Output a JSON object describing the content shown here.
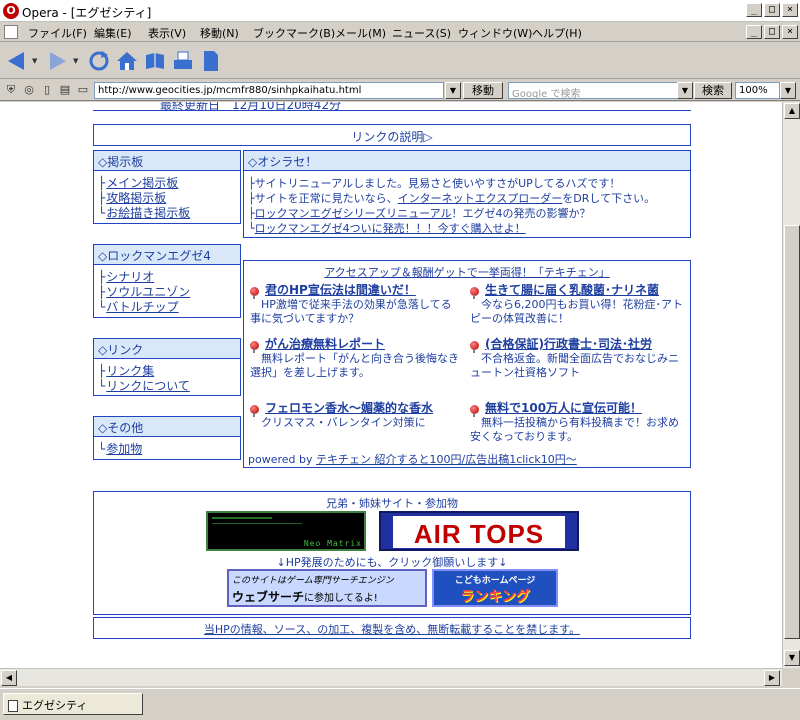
{
  "window": {
    "app_icon": "opera-o-icon",
    "title": "Opera - [エグゼシティ]",
    "buttons": [
      "_",
      "□",
      "×"
    ]
  },
  "menu": {
    "items": [
      "ファイル(F)",
      "編集(E)",
      "表示(V)",
      "移動(N)",
      "ブックマーク(B)",
      "メール(M)",
      "ニュース(S)",
      "ウィンドウ(W)",
      "ヘルプ(H)"
    ]
  },
  "toolbar": {
    "icons": [
      "back-icon",
      "forward-icon",
      "reload-icon",
      "home-icon",
      "bookmarks-icon",
      "print-icon",
      "page-icon"
    ]
  },
  "address": {
    "url": "http://www.geocities.jp/mcmfr880/sinhpkaihatu.html",
    "go_label": "移動",
    "search_placeholder": "Google で検索",
    "search_label": "検索",
    "zoom": "100%"
  },
  "page": {
    "cut_top": "最終更新日　12月10日20時42分",
    "link_desc": "リンクの説明▷",
    "keijiban": {
      "header": "◇掲示板",
      "items": [
        {
          "prefix": "├",
          "text": "メイン掲示板"
        },
        {
          "prefix": "├",
          "text": "攻略掲示板"
        },
        {
          "prefix": "└",
          "text": "お絵描き掲示板"
        }
      ]
    },
    "oshirase": {
      "header": "◇オシラセ！",
      "items": [
        {
          "prefix": "├",
          "text": "サイトリニューアルしました。見易さと使いやすさがUPしてるハズです！"
        },
        {
          "prefix": "├",
          "text": "サイトを正常に見たいなら、",
          "link": "インターネットエクスプローダー",
          "suffix": "をDRして下さい。"
        },
        {
          "prefix": "├",
          "link": "ロックマンエグゼシリーズリニューアル",
          "suffix": "！エグゼ4の発売の影響か？"
        },
        {
          "prefix": "└",
          "link": "ロックマンエグゼ4ついに発売！！！今すぐ購入せよ！"
        }
      ]
    },
    "rockman": {
      "header": "◇ロックマンエグゼ4",
      "items": [
        {
          "prefix": "├",
          "text": "シナリオ"
        },
        {
          "prefix": "├",
          "text": "ソウルユニゾン"
        },
        {
          "prefix": "└",
          "text": "バトルチップ"
        }
      ]
    },
    "link": {
      "header": "◇リンク",
      "items": [
        {
          "prefix": "├",
          "text": "リンク集"
        },
        {
          "prefix": "└",
          "text": "リンクについて"
        }
      ]
    },
    "sonota": {
      "header": "◇その他",
      "items": [
        {
          "prefix": "└",
          "text": "参加物"
        }
      ]
    },
    "ads": {
      "header": "アクセスアップ＆報酬ゲットで一挙両得！「テキチェン」",
      "left": [
        {
          "title": "君のHP宣伝法は間違いだ！",
          "desc": "　HP激増で従来手法の効果が急落してる事に気づいてますか？"
        },
        {
          "title": "がん治療無料レポート",
          "desc": "　無料レポート「がんと向き合う後悔なき選択」を差し上げます。"
        },
        {
          "title": "フェロモン香水～媚薬的な香水",
          "desc": "　クリスマス・バレンタイン対策に"
        }
      ],
      "right": [
        {
          "title": "生きて腸に届く乳酸菌･ナリネ菌",
          "desc": "　今なら6,200円もお買い得！花粉症･アトピーの体質改善に！"
        },
        {
          "title": "(合格保証)行政書士･司法･社労",
          "desc": "　不合格返金。新聞全面広告でおなじみニュートン社資格ソフト"
        },
        {
          "title": "無料で100万人に宣伝可能！",
          "desc": "　無料一括投稿から有料投稿まで！お求め安くなっております。"
        }
      ],
      "footer_prefix": "powered by ",
      "footer_link": "テキチェン 紹介すると100円/広告出稿1click10円～"
    },
    "sister": {
      "title": "兄弟・姉妹サイト・参加物",
      "neo_matrix": "Neo Matrix",
      "airtops": "AIR TOPS",
      "cta": "↓HP発展のためにも、クリック御願いします↓",
      "web_search_line1": "このサイトはゲーム専門サーチエンジン",
      "web_search_line2a": "ウェブサーチ",
      "web_search_line2b": "に参加してるよ!",
      "kodomo_line1": "こどもホームページ",
      "kodomo_line2": "ランキング"
    },
    "copyright": "当HPの情報、ソース、の加工、複製を含め、無断転載することを禁じます。"
  },
  "status": {
    "tab_icon": "page-icon",
    "tab_label": "エグゼシティ"
  },
  "colors": {
    "link_blue": "#1f3fa0",
    "header_bg": "#d8e8f8",
    "border_blue": "#1f45c0",
    "ad_red": "#b00000"
  }
}
